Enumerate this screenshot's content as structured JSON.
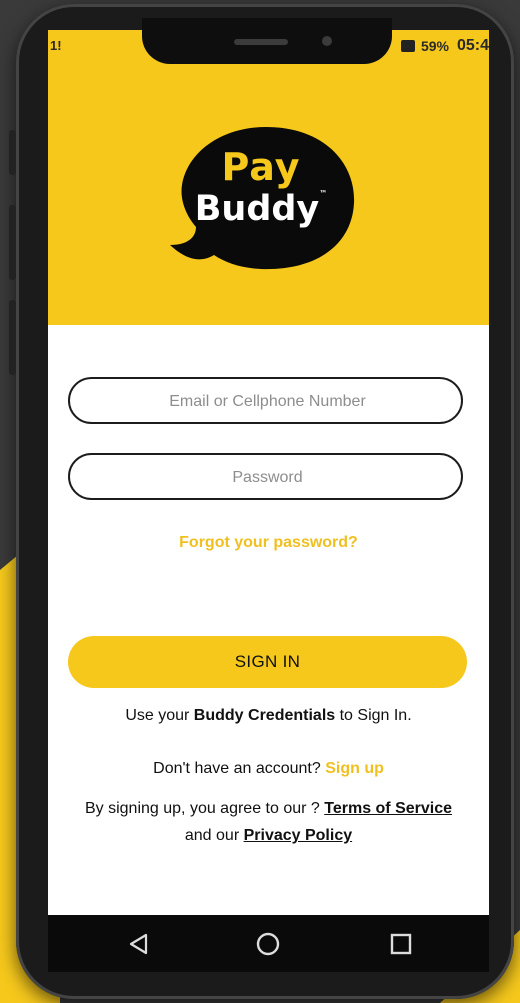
{
  "status": {
    "left": "1!",
    "battery": "59%",
    "time": "05:4"
  },
  "logo": {
    "line1": "Pay",
    "line2": "Buddy",
    "trademark": "™"
  },
  "form": {
    "email_placeholder": "Email or Cellphone Number",
    "password_placeholder": "Password",
    "forgot_label": "Forgot your password?",
    "signin_label": "SIGN IN"
  },
  "credentials": {
    "prefix": "Use your ",
    "bold": "Buddy Credentials",
    "suffix": " to Sign In."
  },
  "signup": {
    "prefix": "Don't have an account? ",
    "link": "Sign up"
  },
  "legal": {
    "prefix": "By signing up, you agree to our ? ",
    "terms": "Terms of Service ",
    "and": "and our ",
    "privacy": "Privacy Policy"
  },
  "colors": {
    "brand_yellow": "#f6c81c",
    "dark": "#111111"
  },
  "navbar": {
    "icons": [
      "back-icon",
      "home-icon",
      "recents-icon"
    ]
  }
}
